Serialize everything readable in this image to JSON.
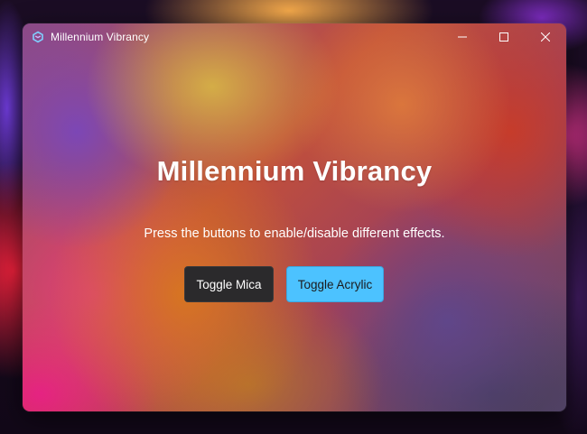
{
  "window": {
    "title": "Millennium Vibrancy",
    "icon": "millennium-logo-icon",
    "caption_icons": [
      "minimize-icon",
      "maximize-icon",
      "close-icon"
    ]
  },
  "main": {
    "heading": "Millennium Vibrancy",
    "subtitle": "Press the buttons to enable/disable different effects.",
    "buttons": {
      "mica_label": "Toggle Mica",
      "acrylic_label": "Toggle Acrylic"
    }
  },
  "colors": {
    "accent": "#4cc2ff",
    "dark_button": "#2b2a2c",
    "text": "#ffffff"
  }
}
